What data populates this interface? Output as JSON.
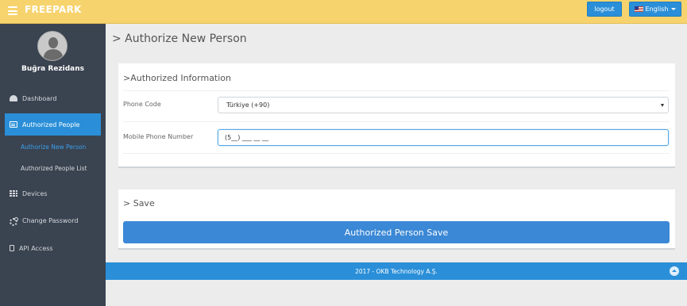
{
  "header": {
    "brand": "FREEPARK",
    "logout_label": "logout",
    "language_label": "English"
  },
  "sidebar": {
    "user_name": "Buğra Rezidans",
    "items": [
      {
        "label": "Dashboard",
        "icon": "dashboard-icon"
      },
      {
        "label": "Authorized People",
        "icon": "id-card-icon",
        "active": true
      },
      {
        "label": "Devices",
        "icon": "grid-icon"
      },
      {
        "label": "Change Password",
        "icon": "gears-icon"
      },
      {
        "label": "API Access",
        "icon": "mobile-icon"
      }
    ],
    "subitems": [
      {
        "label": "Authorize New Person",
        "active": true
      },
      {
        "label": "Authorized People List"
      }
    ]
  },
  "main": {
    "page_title": "> Authorize New Person",
    "info_panel": {
      "title": ">Authorized Information",
      "phone_code_label": "Phone Code",
      "phone_code_value": "Türkiye (+90)",
      "mobile_label": "Mobile Phone Number",
      "mobile_value": "(5__) ___ __ __"
    },
    "save_panel": {
      "title": "> Save",
      "button_label": "Authorized Person Save"
    }
  },
  "footer": {
    "text": "2017 - OKB Technology A.Ş."
  },
  "colors": {
    "topbar": "#f7d36e",
    "sidebar": "#3a4350",
    "accent": "#2a8fd8",
    "save_button": "#3b88d6"
  }
}
